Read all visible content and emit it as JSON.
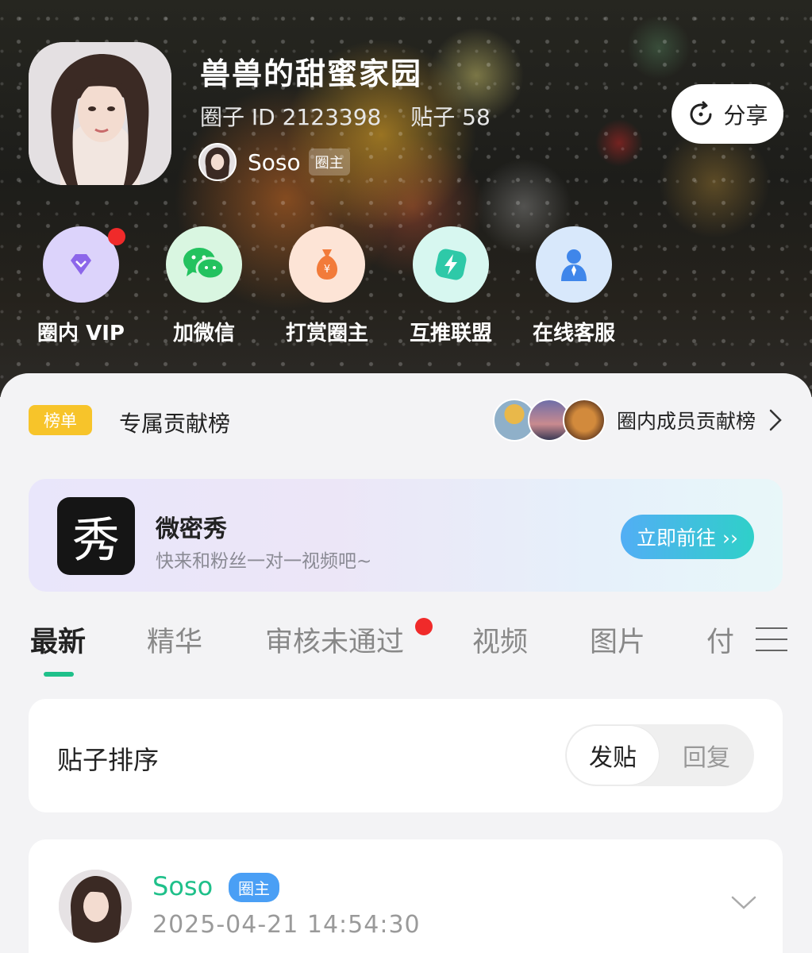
{
  "header": {
    "title": "兽兽的甜蜜家园",
    "circle_id": "圈子 ID 2123398",
    "posts": "贴子 58",
    "owner_name": "Soso",
    "owner_tag": "圈主",
    "share_label": "分享"
  },
  "quick_actions": [
    {
      "label": "圈内 VIP",
      "icon": "diamond-icon",
      "color": "#dcd3fb"
    },
    {
      "label": "加微信",
      "icon": "wechat-icon",
      "color": "#d9f6e1"
    },
    {
      "label": "打赏圈主",
      "icon": "money-bag-icon",
      "color": "#fde4d6"
    },
    {
      "label": "互推联盟",
      "icon": "lightning-icon",
      "color": "#d7f7f0"
    },
    {
      "label": "在线客服",
      "icon": "support-agent-icon",
      "color": "#d8e8fb"
    }
  ],
  "ranking": {
    "badge": "榜单",
    "title": "专属贡献榜",
    "link": "圈内成员贡献榜"
  },
  "ad": {
    "logo_char": "秀",
    "title": "微密秀",
    "subtitle": "快来和粉丝一对一视频吧~",
    "button": "立即前往 ››"
  },
  "tabs": [
    "最新",
    "精华",
    "审核未通过",
    "视频",
    "图片",
    "付"
  ],
  "sort": {
    "label": "贴子排序",
    "options": [
      "发贴",
      "回复"
    ],
    "selected": "发贴"
  },
  "post": {
    "author": "Soso",
    "author_tag": "圈主",
    "time": "2025-04-21 14:54:30"
  },
  "colors": {
    "accent_green": "#1fc08a",
    "badge_yellow": "#f7c42a",
    "notify_red": "#f02a2a",
    "tag_blue": "#4a9ff5"
  }
}
